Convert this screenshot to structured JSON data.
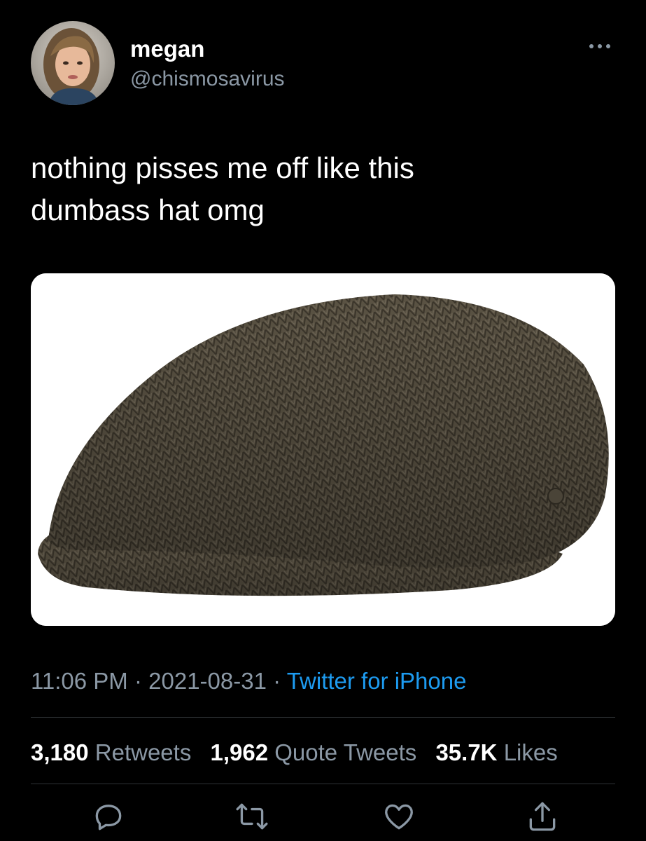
{
  "user": {
    "display_name": "megan",
    "handle": "@chismosavirus",
    "avatar_icon": "user-avatar"
  },
  "tweet": {
    "text": "nothing pisses me off like this\ndumbass hat omg",
    "media_icon": "flat-cap-photo"
  },
  "meta": {
    "time": "11:06 PM",
    "separator": " · ",
    "date": "2021-08-31",
    "source": "Twitter for iPhone"
  },
  "stats": [
    {
      "value": "3,180",
      "label": "Retweets"
    },
    {
      "value": "1,962",
      "label": "Quote Tweets"
    },
    {
      "value": "35.7K",
      "label": "Likes"
    }
  ],
  "actions": [
    "reply-icon",
    "retweet-icon",
    "like-icon",
    "share-icon"
  ],
  "colors": {
    "background": "#000000",
    "text": "#ffffff",
    "secondary": "#8b98a5",
    "link": "#1d9bf0",
    "divider": "#2f3336"
  }
}
